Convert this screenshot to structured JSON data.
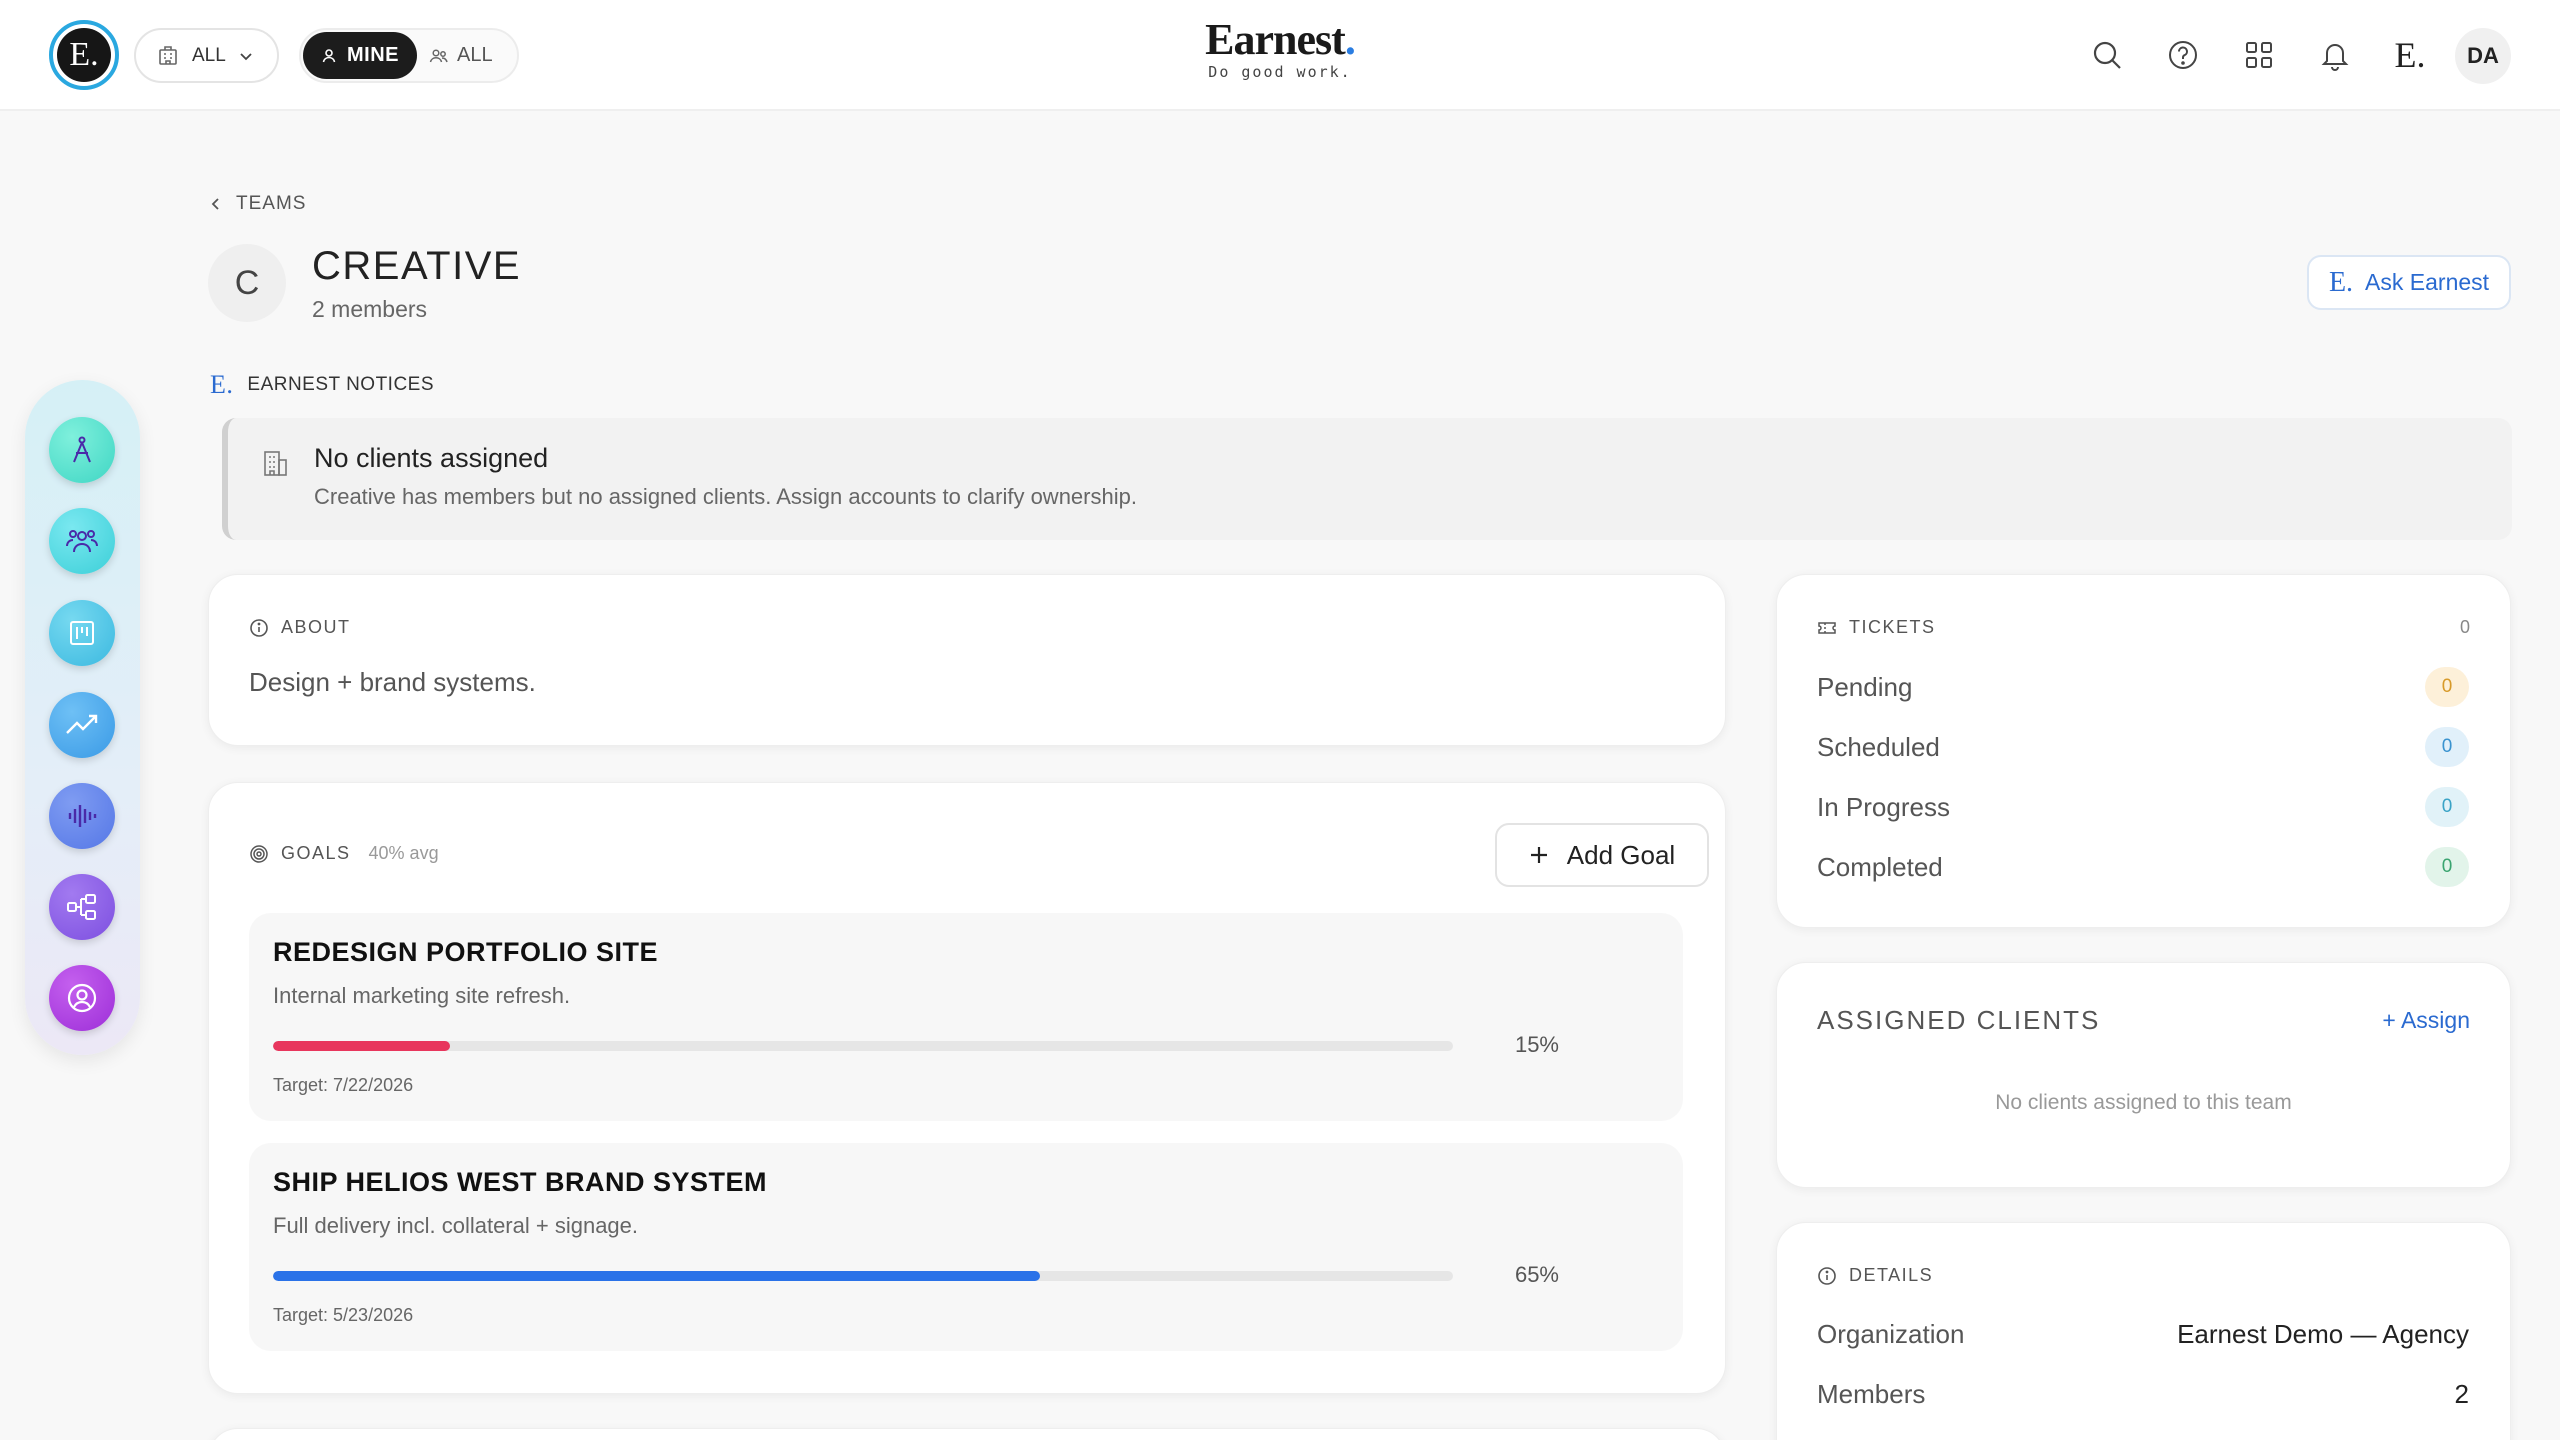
{
  "header": {
    "logo_letter": "E.",
    "scope_label": "ALL",
    "filter_mine": "MINE",
    "filter_all": "ALL",
    "brand_name": "Earnest",
    "brand_dot": ".",
    "brand_tagline": "Do good work.",
    "earnest_mark": "E.",
    "avatar_initials": "DA"
  },
  "rail": {
    "items": [
      {
        "icon": "compass-icon",
        "color": "#3fd6c4"
      },
      {
        "icon": "team-icon",
        "color": "#3ccfd8"
      },
      {
        "icon": "board-icon",
        "color": "#3cb9e0"
      },
      {
        "icon": "trend-icon",
        "color": "#3a9ae6"
      },
      {
        "icon": "waveform-icon",
        "color": "#5577e6"
      },
      {
        "icon": "flow-icon",
        "color": "#7d4fe0"
      },
      {
        "icon": "user-circle-icon",
        "color": "#9d2ed8"
      }
    ]
  },
  "breadcrumb": {
    "label": "TEAMS"
  },
  "team": {
    "initial": "C",
    "name": "CREATIVE",
    "members": "2 members"
  },
  "ask": {
    "mark": "E.",
    "label": "Ask Earnest"
  },
  "notices": {
    "mark": "E.",
    "label": "EARNEST NOTICES",
    "items": [
      {
        "title": "No clients assigned",
        "text": "Creative has members but no assigned clients. Assign accounts to clarify ownership."
      }
    ]
  },
  "about": {
    "label": "ABOUT",
    "text": "Design + brand systems."
  },
  "goals": {
    "label": "GOALS",
    "avg": "40% avg",
    "add_label": "Add Goal",
    "items": [
      {
        "title": "REDESIGN PORTFOLIO SITE",
        "description": "Internal marketing site refresh.",
        "progress": 15,
        "progress_label": "15%",
        "target": "Target: 7/22/2026",
        "color": "#e8365d"
      },
      {
        "title": "SHIP HELIOS WEST BRAND SYSTEM",
        "description": "Full delivery incl. collateral + signage.",
        "progress": 65,
        "progress_label": "65%",
        "target": "Target: 5/23/2026",
        "color": "#2a72e8"
      }
    ]
  },
  "tickets": {
    "label": "TICKETS",
    "total": "0",
    "rows": [
      {
        "label": "Pending",
        "count": "0",
        "bg": "#fdf0d9",
        "fg": "#d79a2a"
      },
      {
        "label": "Scheduled",
        "count": "0",
        "bg": "#e1f0fa",
        "fg": "#3a93cf"
      },
      {
        "label": "In Progress",
        "count": "0",
        "bg": "#e1f2f8",
        "fg": "#3aa3c6"
      },
      {
        "label": "Completed",
        "count": "0",
        "bg": "#e2f4ea",
        "fg": "#3aa470"
      }
    ]
  },
  "clients": {
    "title": "ASSIGNED CLIENTS",
    "assign": "+ Assign",
    "empty": "No clients assigned to this team"
  },
  "details": {
    "label": "DETAILS",
    "rows": [
      {
        "key": "Organization",
        "value": "Earnest Demo — Agency"
      },
      {
        "key": "Members",
        "value": "2"
      }
    ]
  }
}
